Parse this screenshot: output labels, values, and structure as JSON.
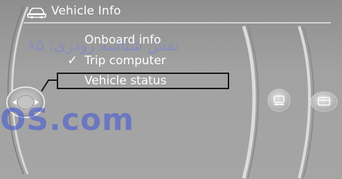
{
  "header": {
    "title": "Vehicle Info",
    "icon": "car-icon"
  },
  "menu": {
    "items": [
      {
        "label": "Onboard info",
        "checked": false,
        "selected": false
      },
      {
        "label": "Trip computer",
        "checked": true,
        "selected": false
      },
      {
        "label": "Vehicle status",
        "checked": false,
        "selected": true
      }
    ],
    "check_glyph": "✓"
  },
  "controller": {
    "icon": "controller-knob-icon"
  },
  "side_icons": [
    "vehicle-settings-icon",
    "card-icon"
  ],
  "watermark": {
    "persian": "نقش شناسه رودری: ۸۵",
    "latin": "OS.com"
  },
  "colors": {
    "background": "#a0a0a0",
    "text": "#ffffff",
    "selection_border": "#141414"
  }
}
